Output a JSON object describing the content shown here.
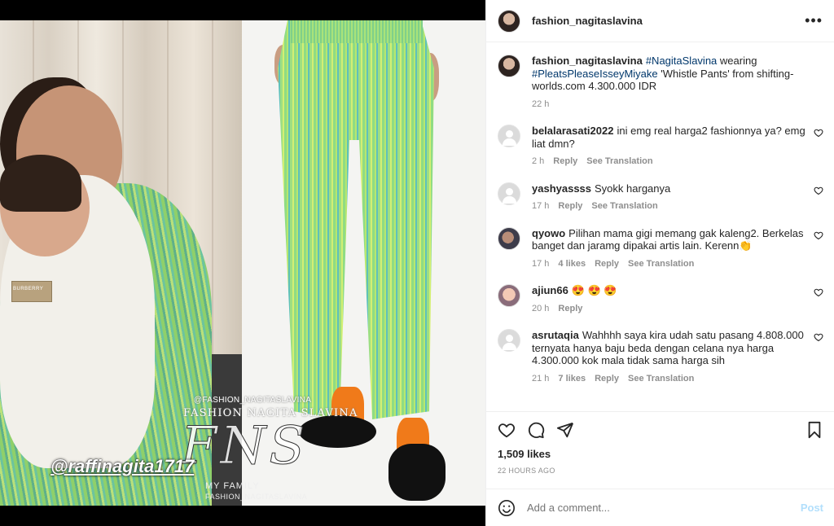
{
  "header": {
    "username": "fashion_nagitaslavina",
    "more_icon": "more-horizontal-icon"
  },
  "caption": {
    "username": "fashion_nagitaslavina",
    "tag1": "#NagitaSlavina",
    "text1": " wearing ",
    "tag2": "#PleatsPleaseIsseyMiyake",
    "text2": " 'Whistle Pants' from shifting-worlds.com 4.300.000 IDR",
    "time": "22 h"
  },
  "comments": [
    {
      "username": "belalarasati2022",
      "text": "ini emg real harga2 fashionnya ya? emg liat dmn?",
      "time": "2 h",
      "likes": "",
      "reply": "Reply",
      "translate": "See Translation"
    },
    {
      "username": "yashyassss",
      "text": "Syokk harganya",
      "time": "17 h",
      "likes": "",
      "reply": "Reply",
      "translate": "See Translation"
    },
    {
      "username": "qyowo",
      "text": "Pilihan mama gigi memang gak kaleng2. Berkelas banget dan jaramg dipakai artis lain. Kerenn👏",
      "time": "17 h",
      "likes": "4 likes",
      "reply": "Reply",
      "translate": "See Translation"
    },
    {
      "username": "ajiun66",
      "text": "😍 😍 😍",
      "time": "20 h",
      "likes": "",
      "reply": "Reply",
      "translate": ""
    },
    {
      "username": "asrutaqia",
      "text": "Wahhhh saya kira udah satu pasang 4.808.000 ternyata hanya baju beda dengan celana nya harga 4.300.000 kok mala tidak sama harga sih",
      "time": "21 h",
      "likes": "7 likes",
      "reply": "Reply",
      "translate": "See Translation"
    }
  ],
  "stats": {
    "likes": "1,509 likes",
    "ago": "22 HOURS AGO"
  },
  "add_comment": {
    "placeholder": "Add a comment...",
    "post": "Post"
  },
  "media": {
    "wm_handle": "@FASHION_NAGITASLAVINA",
    "wm_brand": "FASHION NAGITA SLAVINA",
    "wm_logo": "FNS",
    "wm_raffi": "@raffinagita1717",
    "wm_family": "MY FAMILY",
    "wm_small": "FASHION_NAGITASLAVINA",
    "baby_label": "BURBERRY"
  },
  "colors": {
    "link": "#00376b",
    "text": "#262626",
    "muted": "#8e8e8e",
    "post_disabled": "#b2dffc"
  }
}
